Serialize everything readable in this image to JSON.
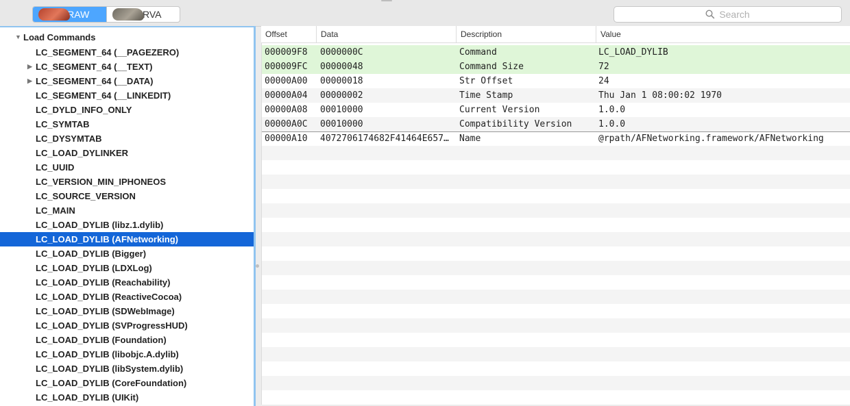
{
  "toolbar": {
    "segments": [
      {
        "label": "RAW",
        "active": true,
        "icon": "raw-mode-icon"
      },
      {
        "label": "RVA",
        "active": false,
        "icon": "rva-mode-icon"
      }
    ],
    "search_placeholder": "Search"
  },
  "tree": {
    "root": "Load Commands",
    "items": [
      {
        "label": "LC_SEGMENT_64 (__PAGEZERO)",
        "expandable": false,
        "selected": false
      },
      {
        "label": "LC_SEGMENT_64 (__TEXT)",
        "expandable": true,
        "selected": false
      },
      {
        "label": "LC_SEGMENT_64 (__DATA)",
        "expandable": true,
        "selected": false
      },
      {
        "label": "LC_SEGMENT_64 (__LINKEDIT)",
        "expandable": false,
        "selected": false
      },
      {
        "label": "LC_DYLD_INFO_ONLY",
        "expandable": false,
        "selected": false
      },
      {
        "label": "LC_SYMTAB",
        "expandable": false,
        "selected": false
      },
      {
        "label": "LC_DYSYMTAB",
        "expandable": false,
        "selected": false
      },
      {
        "label": "LC_LOAD_DYLINKER",
        "expandable": false,
        "selected": false
      },
      {
        "label": "LC_UUID",
        "expandable": false,
        "selected": false
      },
      {
        "label": "LC_VERSION_MIN_IPHONEOS",
        "expandable": false,
        "selected": false
      },
      {
        "label": "LC_SOURCE_VERSION",
        "expandable": false,
        "selected": false
      },
      {
        "label": "LC_MAIN",
        "expandable": false,
        "selected": false
      },
      {
        "label": "LC_LOAD_DYLIB (libz.1.dylib)",
        "expandable": false,
        "selected": false
      },
      {
        "label": "LC_LOAD_DYLIB (AFNetworking)",
        "expandable": false,
        "selected": true
      },
      {
        "label": "LC_LOAD_DYLIB (Bigger)",
        "expandable": false,
        "selected": false
      },
      {
        "label": "LC_LOAD_DYLIB (LDXLog)",
        "expandable": false,
        "selected": false
      },
      {
        "label": "LC_LOAD_DYLIB (Reachability)",
        "expandable": false,
        "selected": false
      },
      {
        "label": "LC_LOAD_DYLIB (ReactiveCocoa)",
        "expandable": false,
        "selected": false
      },
      {
        "label": "LC_LOAD_DYLIB (SDWebImage)",
        "expandable": false,
        "selected": false
      },
      {
        "label": "LC_LOAD_DYLIB (SVProgressHUD)",
        "expandable": false,
        "selected": false
      },
      {
        "label": "LC_LOAD_DYLIB (Foundation)",
        "expandable": false,
        "selected": false
      },
      {
        "label": "LC_LOAD_DYLIB (libobjc.A.dylib)",
        "expandable": false,
        "selected": false
      },
      {
        "label": "LC_LOAD_DYLIB (libSystem.dylib)",
        "expandable": false,
        "selected": false
      },
      {
        "label": "LC_LOAD_DYLIB (CoreFoundation)",
        "expandable": false,
        "selected": false
      },
      {
        "label": "LC_LOAD_DYLIB (UIKit)",
        "expandable": false,
        "selected": false
      }
    ]
  },
  "table": {
    "columns": [
      "Offset",
      "Data",
      "Description",
      "Value"
    ],
    "rows": [
      {
        "offset": "000009F8",
        "data": "0000000C",
        "description": "Command",
        "value": "LC_LOAD_DYLIB",
        "highlight": true
      },
      {
        "offset": "000009FC",
        "data": "00000048",
        "description": "Command Size",
        "value": "72",
        "highlight": true
      },
      {
        "offset": "00000A00",
        "data": "00000018",
        "description": "Str Offset",
        "value": "24",
        "highlight": false
      },
      {
        "offset": "00000A04",
        "data": "00000002",
        "description": "Time Stamp",
        "value": "Thu Jan  1 08:00:02 1970",
        "highlight": false
      },
      {
        "offset": "00000A08",
        "data": "00010000",
        "description": "Current Version",
        "value": "1.0.0",
        "highlight": false
      },
      {
        "offset": "00000A0C",
        "data": "00010000",
        "description": "Compatibility Version",
        "value": "1.0.0",
        "highlight": false
      },
      {
        "offset": "00000A10",
        "data": "4072706174682F41464E657…",
        "description": "Name",
        "value": "@rpath/AFNetworking.framework/AFNetworking",
        "highlight": false
      }
    ]
  },
  "colors": {
    "selection": "#1466d8",
    "highlight_row": "#dff6d8",
    "segment_active": "#4da6ff"
  }
}
